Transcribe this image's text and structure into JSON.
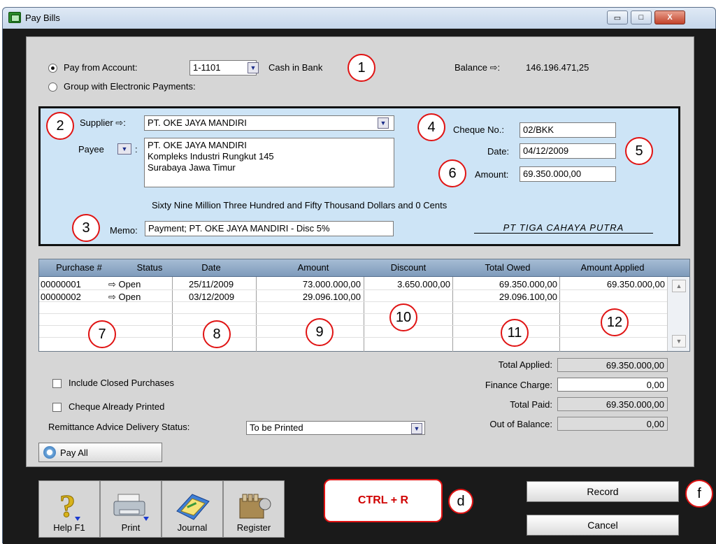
{
  "window": {
    "title": "Pay Bills",
    "min_glyph": "▭",
    "max_glyph": "□",
    "close_glyph": "X"
  },
  "pay_from": {
    "radio_label": "Pay from Account:",
    "account_code": "1-1101",
    "account_name": "Cash in Bank",
    "balance_label": "Balance ⇨:",
    "balance_value": "146.196.471,25"
  },
  "group_electronic": {
    "label": "Group with Electronic Payments:"
  },
  "cheque": {
    "supplier_label": "Supplier ⇨:",
    "supplier_value": "PT. OKE JAYA MANDIRI",
    "payee_label": "Payee",
    "payee_colon": ":",
    "payee_lines": [
      "PT. OKE JAYA MANDIRI",
      "Kompleks Industri Rungkut 145",
      "Surabaya  Jawa Timur"
    ],
    "cheque_no_label": "Cheque No.:",
    "cheque_no_value": "02/BKK",
    "date_label": "Date:",
    "date_value": "04/12/2009",
    "amount_label": "Amount:",
    "amount_value": "69.350.000,00",
    "amount_words": "Sixty Nine Million Three Hundred and Fifty Thousand Dollars and 0 Cents",
    "memo_label": "Memo:",
    "memo_value": "Payment; PT. OKE JAYA MANDIRI - Disc 5%",
    "signature": "PT TIGA CAHAYA PUTRA"
  },
  "table": {
    "headers": [
      "Purchase #",
      "Status",
      "Date",
      "Amount",
      "Discount",
      "Total Owed",
      "Amount Applied"
    ],
    "rows": [
      {
        "purchase": "00000001",
        "status": "⇨ Open",
        "date": "25/11/2009",
        "amount": "73.000.000,00",
        "discount": "3.650.000,00",
        "total_owed": "69.350.000,00",
        "applied": "69.350.000,00"
      },
      {
        "purchase": "00000002",
        "status": "⇨ Open",
        "date": "03/12/2009",
        "amount": "29.096.100,00",
        "discount": "",
        "total_owed": "29.096.100,00",
        "applied": ""
      }
    ]
  },
  "options": {
    "include_closed": "Include Closed Purchases",
    "cheque_printed": "Cheque Already Printed",
    "remittance_label": "Remittance Advice Delivery Status:",
    "remittance_value": "To be Printed"
  },
  "totals": {
    "total_applied_label": "Total Applied:",
    "total_applied_value": "69.350.000,00",
    "finance_charge_label": "Finance Charge:",
    "finance_charge_value": "0,00",
    "total_paid_label": "Total Paid:",
    "total_paid_value": "69.350.000,00",
    "out_of_balance_label": "Out of Balance:",
    "out_of_balance_value": "0,00"
  },
  "pay_all": {
    "label": "Pay All"
  },
  "toolbar": {
    "help": "Help F1",
    "print": "Print",
    "journal": "Journal",
    "register": "Register"
  },
  "shortcut": {
    "label": "CTRL + R"
  },
  "buttons": {
    "record": "Record",
    "cancel": "Cancel"
  },
  "callouts": [
    "1",
    "2",
    "3",
    "4",
    "5",
    "6",
    "7",
    "8",
    "9",
    "10",
    "11",
    "12",
    "d",
    "f"
  ],
  "colors": {
    "callout": "#e01313",
    "cheque_bg": "#cde4f6",
    "header_bg": "#8fa9c6"
  },
  "icons": [
    "help-icon",
    "printer-icon",
    "journal-icon",
    "register-icon",
    "pay-all-icon"
  ]
}
